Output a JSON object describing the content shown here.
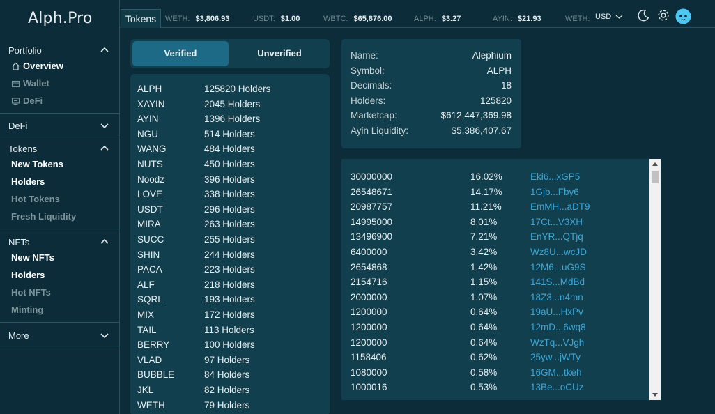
{
  "brand": "Alph.Pro",
  "sidebar": {
    "portfolio": {
      "label": "Portfolio",
      "items": [
        {
          "label": "Overview",
          "icon": "home-icon"
        },
        {
          "label": "Wallet",
          "icon": "wallet-icon"
        },
        {
          "label": "DeFi",
          "icon": "defi-icon"
        }
      ]
    },
    "defi": {
      "label": "DeFi"
    },
    "tokens": {
      "label": "Tokens",
      "items": [
        "New Tokens",
        "Holders",
        "Hot Tokens",
        "Fresh Liquidity"
      ]
    },
    "nfts": {
      "label": "NFTs",
      "items": [
        "New NFTs",
        "Holders",
        "Hot NFTs",
        "Minting"
      ]
    },
    "more": {
      "label": "More"
    }
  },
  "topbar": {
    "tab": "Tokens",
    "tickers": [
      {
        "symbol": "WETH:",
        "price": "$3,806.93"
      },
      {
        "symbol": "USDT:",
        "price": "$1.00"
      },
      {
        "symbol": "WBTC:",
        "price": "$65,876.00"
      },
      {
        "symbol": "ALPH:",
        "price": "$3.27"
      },
      {
        "symbol": "AYIN:",
        "price": "$21.93"
      },
      {
        "symbol": "WETH:",
        "price": ""
      }
    ],
    "currency": "USD"
  },
  "toggle": {
    "verified": "Verified",
    "unverified": "Unverified"
  },
  "tokens": [
    {
      "symbol": "ALPH",
      "holders": "125820 Holders"
    },
    {
      "symbol": "XAYIN",
      "holders": "2045 Holders"
    },
    {
      "symbol": "AYIN",
      "holders": "1396 Holders"
    },
    {
      "symbol": "NGU",
      "holders": "514 Holders"
    },
    {
      "symbol": "WANG",
      "holders": "484 Holders"
    },
    {
      "symbol": "NUTS",
      "holders": "450 Holders"
    },
    {
      "symbol": "Noodz",
      "holders": "396 Holders"
    },
    {
      "symbol": "LOVE",
      "holders": "338 Holders"
    },
    {
      "symbol": "USDT",
      "holders": "296 Holders"
    },
    {
      "symbol": "MIRA",
      "holders": "263 Holders"
    },
    {
      "symbol": "SUCC",
      "holders": "255 Holders"
    },
    {
      "symbol": "SHIN",
      "holders": "244 Holders"
    },
    {
      "symbol": "PACA",
      "holders": "223 Holders"
    },
    {
      "symbol": "ALF",
      "holders": "218 Holders"
    },
    {
      "symbol": "SQRL",
      "holders": "193 Holders"
    },
    {
      "symbol": "MIX",
      "holders": "172 Holders"
    },
    {
      "symbol": "TAIL",
      "holders": "113 Holders"
    },
    {
      "symbol": "BERRY",
      "holders": "100 Holders"
    },
    {
      "symbol": "VLAD",
      "holders": "97 Holders"
    },
    {
      "symbol": "BUBBLE",
      "holders": "84 Holders"
    },
    {
      "symbol": "JKL",
      "holders": "82 Holders"
    },
    {
      "symbol": "WETH",
      "holders": "79 Holders"
    }
  ],
  "info": [
    {
      "key": "Name:",
      "value": "Alephium"
    },
    {
      "key": "Symbol:",
      "value": "ALPH"
    },
    {
      "key": "Decimals:",
      "value": "18"
    },
    {
      "key": "Holders:",
      "value": "125820"
    },
    {
      "key": "Marketcap:",
      "value": "$612,447,369.98"
    },
    {
      "key": "Ayin Liquidity:",
      "value": "$5,386,407.67"
    }
  ],
  "holders": [
    {
      "amount": "30000000",
      "percent": "16.02%",
      "address": "Eki6...xGP5"
    },
    {
      "amount": "26548671",
      "percent": "14.17%",
      "address": "1Gjb...Fby6"
    },
    {
      "amount": "20987757",
      "percent": "11.21%",
      "address": "EmMH...aDT9"
    },
    {
      "amount": "14995000",
      "percent": "8.01%",
      "address": "17Ct...V3XH"
    },
    {
      "amount": "13496900",
      "percent": "7.21%",
      "address": "EnYR...QTjq"
    },
    {
      "amount": "6400000",
      "percent": "3.42%",
      "address": "Wz8U...wcJD"
    },
    {
      "amount": "2654868",
      "percent": "1.42%",
      "address": "12M6...uG9S"
    },
    {
      "amount": "2154716",
      "percent": "1.15%",
      "address": "141S...MdBd"
    },
    {
      "amount": "2000000",
      "percent": "1.07%",
      "address": "18Z3...n4mn"
    },
    {
      "amount": "1200000",
      "percent": "0.64%",
      "address": "19aU...HxPv"
    },
    {
      "amount": "1200000",
      "percent": "0.64%",
      "address": "12mD...6wq8"
    },
    {
      "amount": "1200000",
      "percent": "0.64%",
      "address": "WzTq...VJgh"
    },
    {
      "amount": "1158406",
      "percent": "0.62%",
      "address": "25yw...jWTy"
    },
    {
      "amount": "1080000",
      "percent": "0.58%",
      "address": "16GM...tkeh"
    },
    {
      "amount": "1000016",
      "percent": "0.53%",
      "address": "13Be...oCUz"
    }
  ]
}
